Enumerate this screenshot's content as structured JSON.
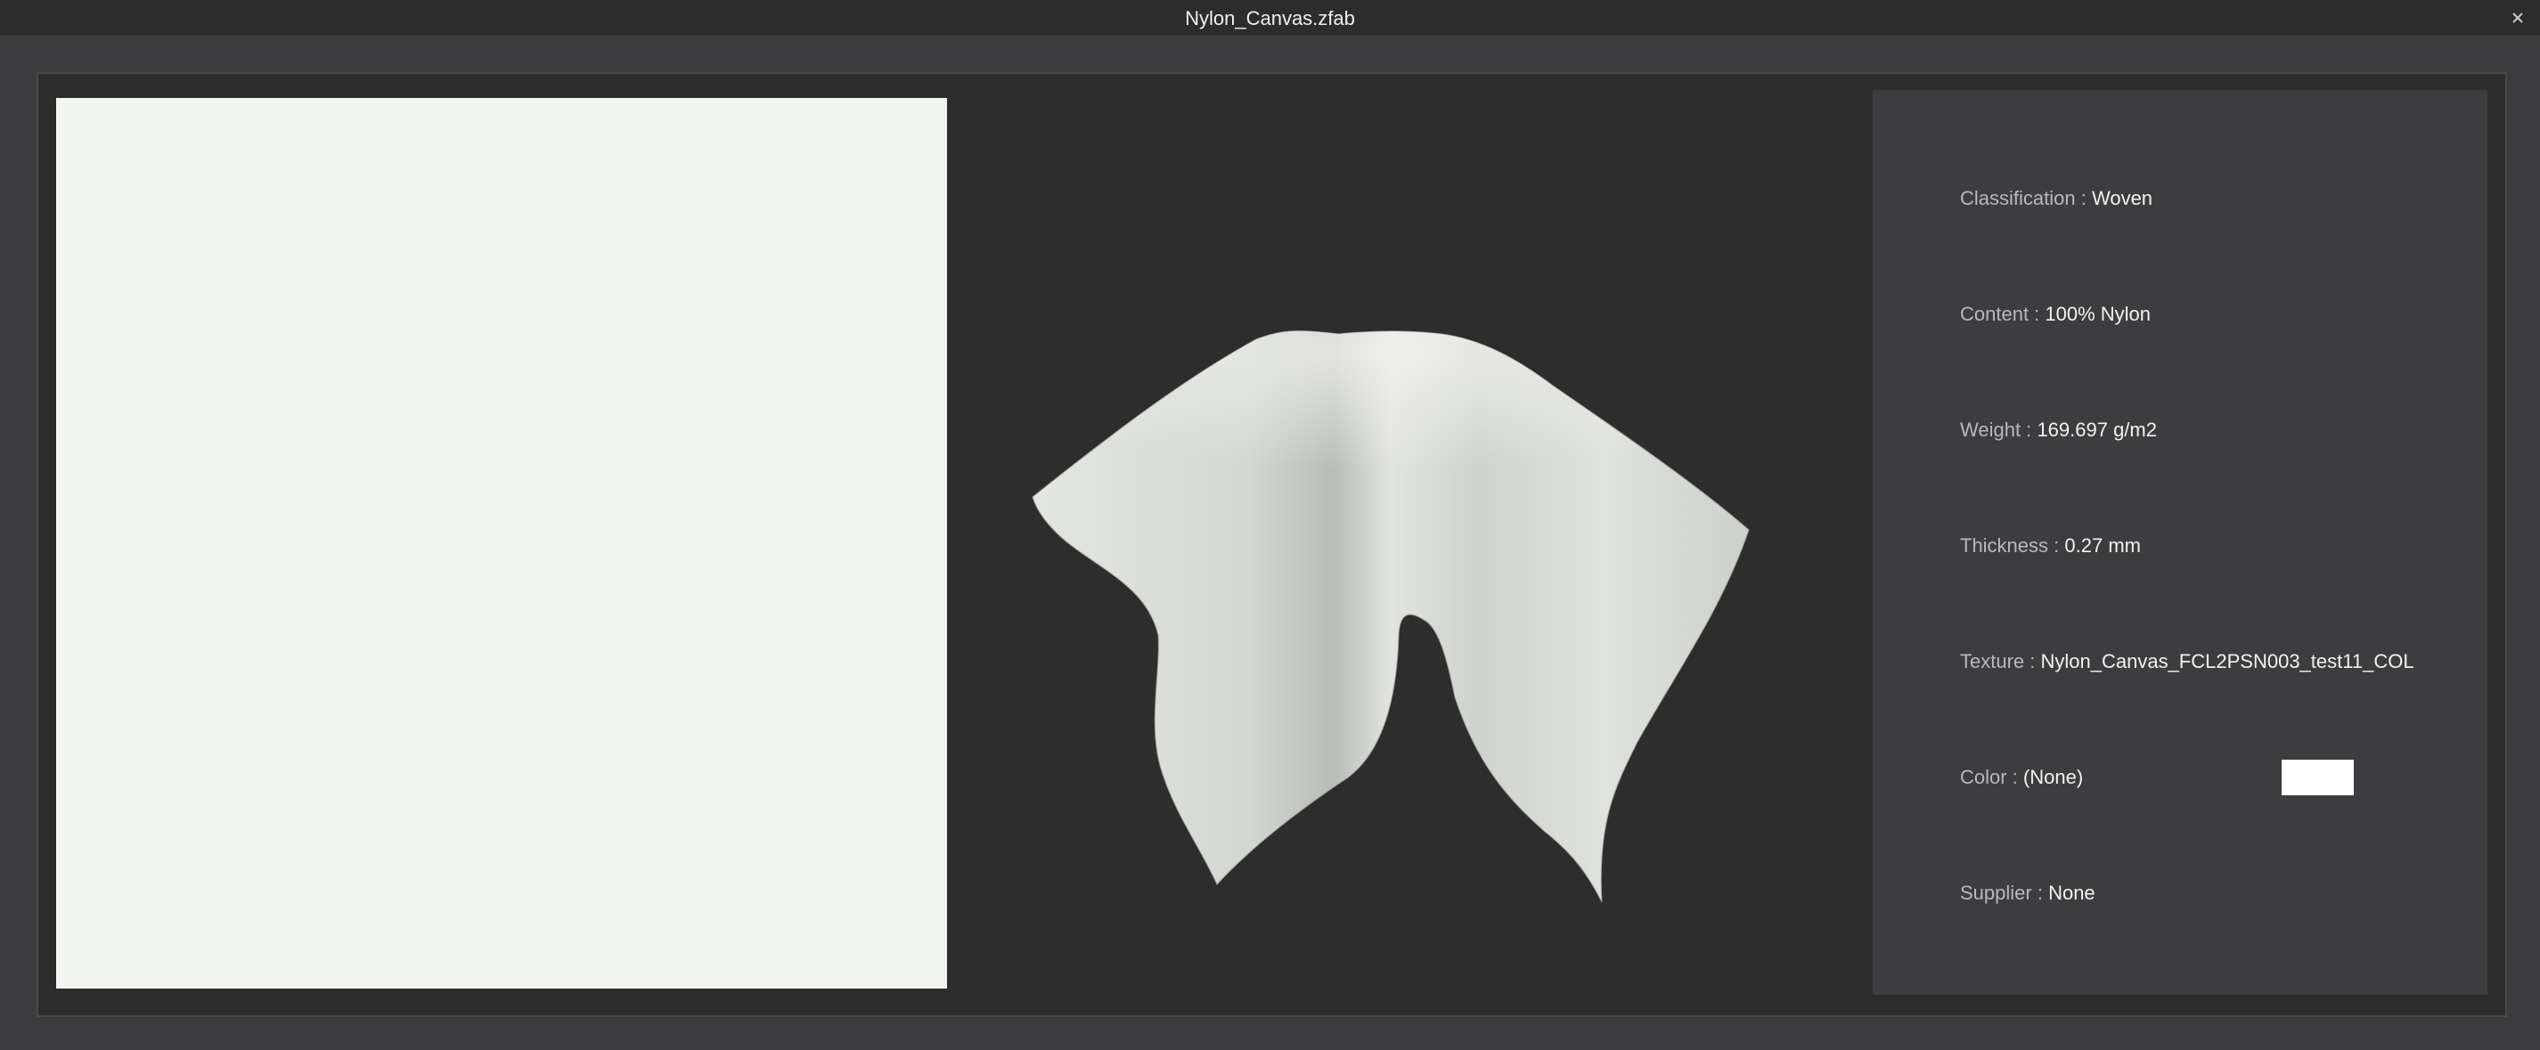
{
  "window": {
    "title": "Nylon_Canvas.zfab",
    "close_glyph": "✕"
  },
  "texture_preview": {
    "color": "#f3f5f0"
  },
  "properties": [
    {
      "key": "classification",
      "label": "Classification :",
      "value": "Woven"
    },
    {
      "key": "content",
      "label": "Content :",
      "value": "100% Nylon"
    },
    {
      "key": "weight",
      "label": "Weight :",
      "value": "169.697 g/m2"
    },
    {
      "key": "thickness",
      "label": "Thickness :",
      "value": "0.27 mm"
    },
    {
      "key": "texture",
      "label": "Texture :",
      "value": "Nylon_Canvas_FCL2PSN003_test11_COL"
    },
    {
      "key": "color",
      "label": "Color :",
      "value": "(None)",
      "swatch": "#ffffff"
    },
    {
      "key": "supplier",
      "label": "Supplier :",
      "value": "None"
    }
  ]
}
